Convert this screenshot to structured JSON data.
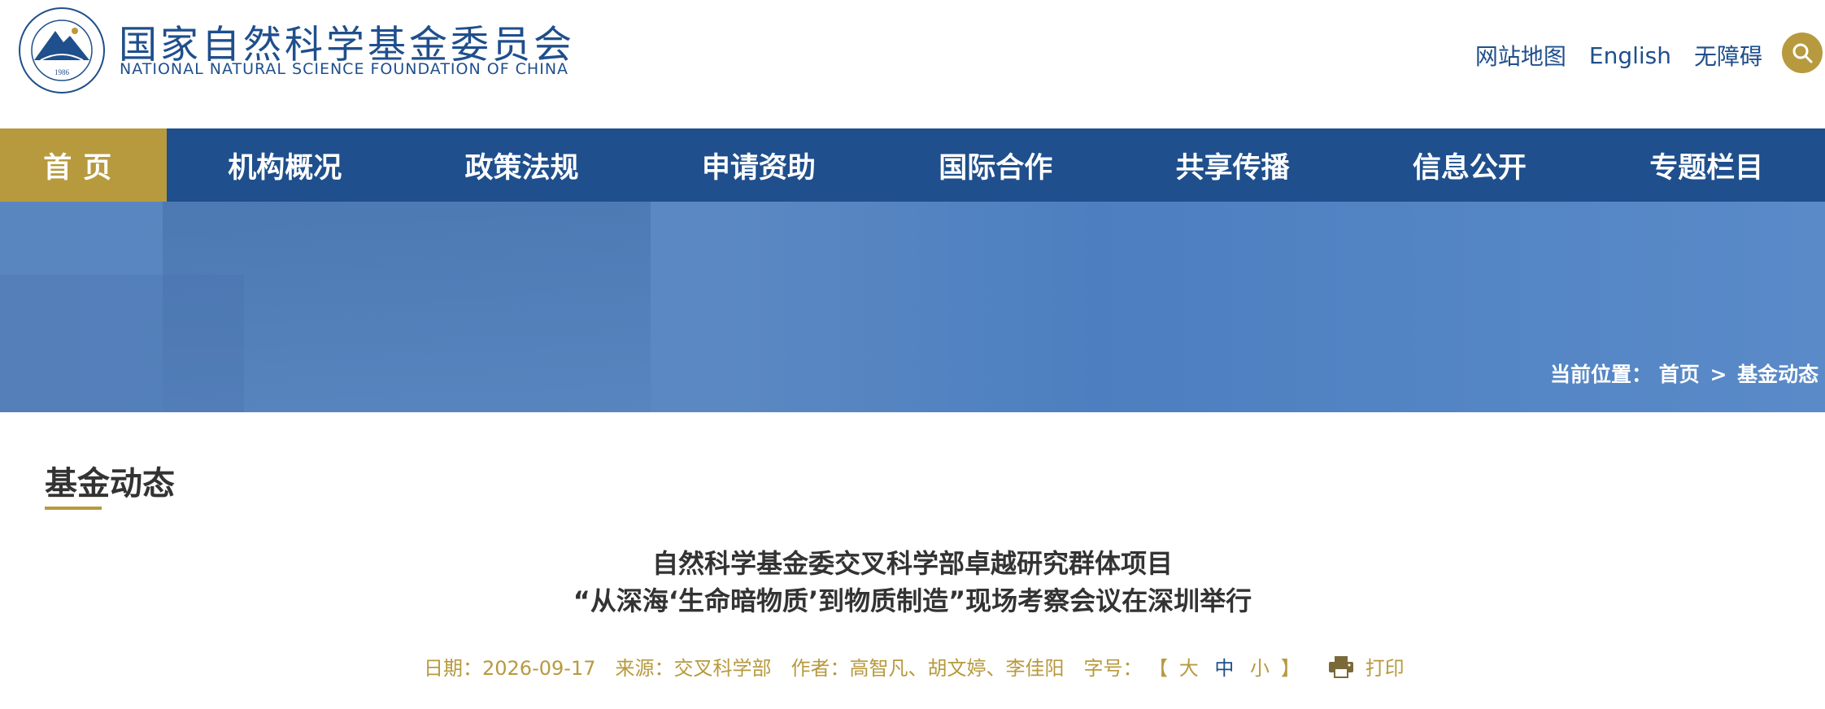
{
  "header": {
    "brand_cn": "国家自然科学基金委员会",
    "brand_en": "NATIONAL NATURAL SCIENCE FOUNDATION OF CHINA",
    "logo_year": "1986",
    "links": {
      "sitemap": "网站地图",
      "english": "English",
      "accessibility": "无障碍"
    },
    "search_icon": "search-icon"
  },
  "nav": {
    "items": [
      "首页",
      "机构概况",
      "政策法规",
      "申请资助",
      "国际合作",
      "共享传播",
      "信息公开",
      "专题栏目"
    ]
  },
  "banner": {
    "breadcrumb_prefix": "当前位置：",
    "breadcrumb_home": "首页",
    "breadcrumb_sep": ">",
    "breadcrumb_current": "基金动态"
  },
  "section": {
    "title": "基金动态"
  },
  "article": {
    "title_line1": "自然科学基金委交叉科学部卓越研究群体项目",
    "title_line2": "“从深海‘生命暗物质’到物质制造”现场考察会议在深圳举行",
    "date_label": "日期：",
    "date": "2026-09-17",
    "source_label": "来源：",
    "source": "交叉科学部",
    "author_label": "作者：",
    "author": "高智凡、胡文婷、李佳阳",
    "fontsize_label": "字号：",
    "bracket_open": "【",
    "size_large": "大",
    "size_medium": "中",
    "size_small": "小",
    "bracket_close": "】",
    "print_label": "打印"
  },
  "colors": {
    "primary_blue": "#1f4f8c",
    "accent_gold": "#b79a3e",
    "banner_blue": "#5986bf"
  }
}
